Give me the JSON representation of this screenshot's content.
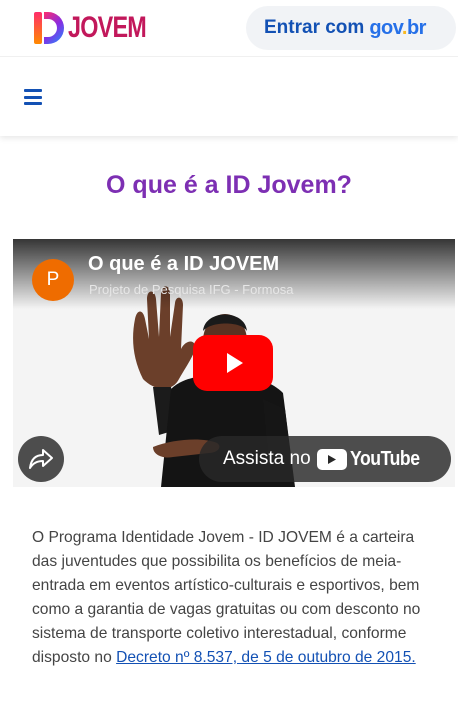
{
  "header": {
    "logo_text": "JOVEM",
    "login_label": "Entrar com",
    "govbr_parts": [
      "gov",
      ".",
      "br"
    ]
  },
  "page": {
    "title": "O que é a ID Jovem?"
  },
  "video": {
    "channel_initial": "P",
    "title": "O que é a ID JOVEM",
    "channel": "Projeto de Pesquisa IFG - Formosa",
    "watch_label": "Assista no",
    "youtube_label": "YouTube"
  },
  "description": {
    "text": "O Programa Identidade Jovem - ID JOVEM é a carteira das juventudes que possibilita os benefícios de meia-entrada em eventos artístico-culturais e esportivos, bem como a garantia de vagas gratuitas ou com desconto no sistema de transporte coletivo interestadual, conforme disposto no ",
    "link_text": "Decreto nº 8.537, de 5 de outubro de 2015."
  },
  "colors": {
    "title": "#7d2fb3",
    "link": "#1351b4",
    "youtube_red": "#ff0000"
  }
}
